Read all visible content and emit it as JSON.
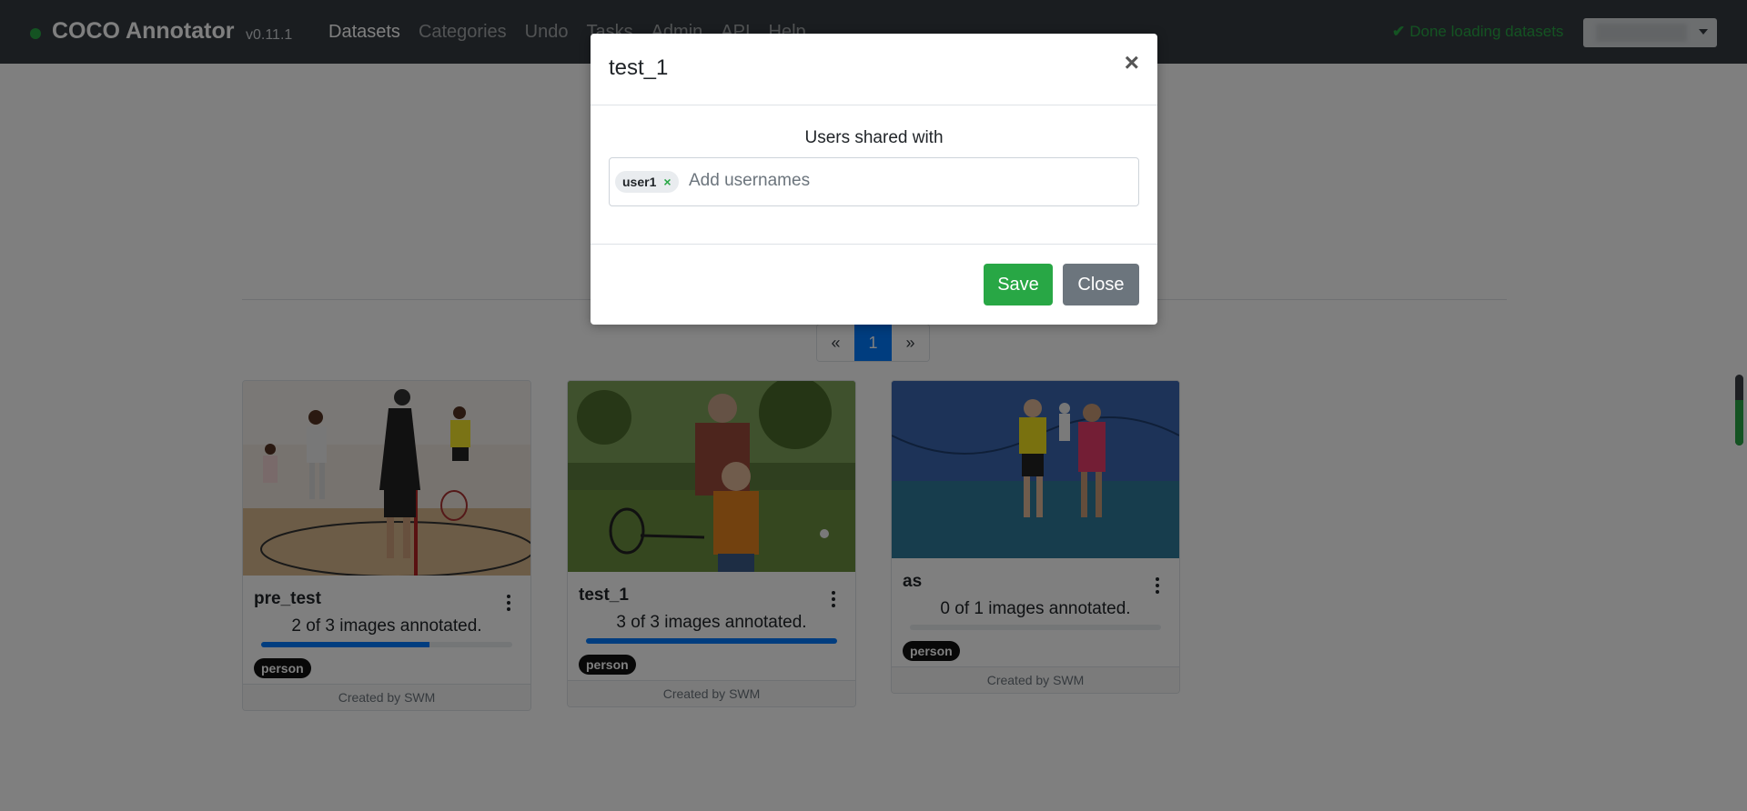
{
  "navbar": {
    "brand": "COCO Annotator",
    "version": "v0.11.1",
    "links": [
      "Datasets",
      "Categories",
      "Undo",
      "Tasks",
      "Admin",
      "API",
      "Help"
    ],
    "active_link": "Datasets",
    "status_text": "Done loading datasets",
    "status_color": "#28a745"
  },
  "pagination": {
    "prev": "«",
    "current": "1",
    "next": "»"
  },
  "datasets": [
    {
      "name": "pre_test",
      "annotated_text": "2 of 3 images annotated.",
      "progress_fraction": 0.67,
      "category": "person",
      "footer": "Created by SWM"
    },
    {
      "name": "test_1",
      "annotated_text": "3 of 3 images annotated.",
      "progress_fraction": 1.0,
      "category": "person",
      "footer": "Created by SWM"
    },
    {
      "name": "as",
      "annotated_text": "0 of 1 images annotated.",
      "progress_fraction": 0.0,
      "category": "person",
      "footer": "Created by SWM"
    }
  ],
  "modal": {
    "title": "test_1",
    "close_icon": "×",
    "share_label": "Users shared with",
    "tag": "user1",
    "tag_remove_icon": "×",
    "input_placeholder": "Add usernames",
    "save_label": "Save",
    "close_label": "Close"
  },
  "colors": {
    "navbar": "#343a40",
    "primary": "#007bff",
    "success": "#28a745",
    "secondary": "#6c757d"
  }
}
